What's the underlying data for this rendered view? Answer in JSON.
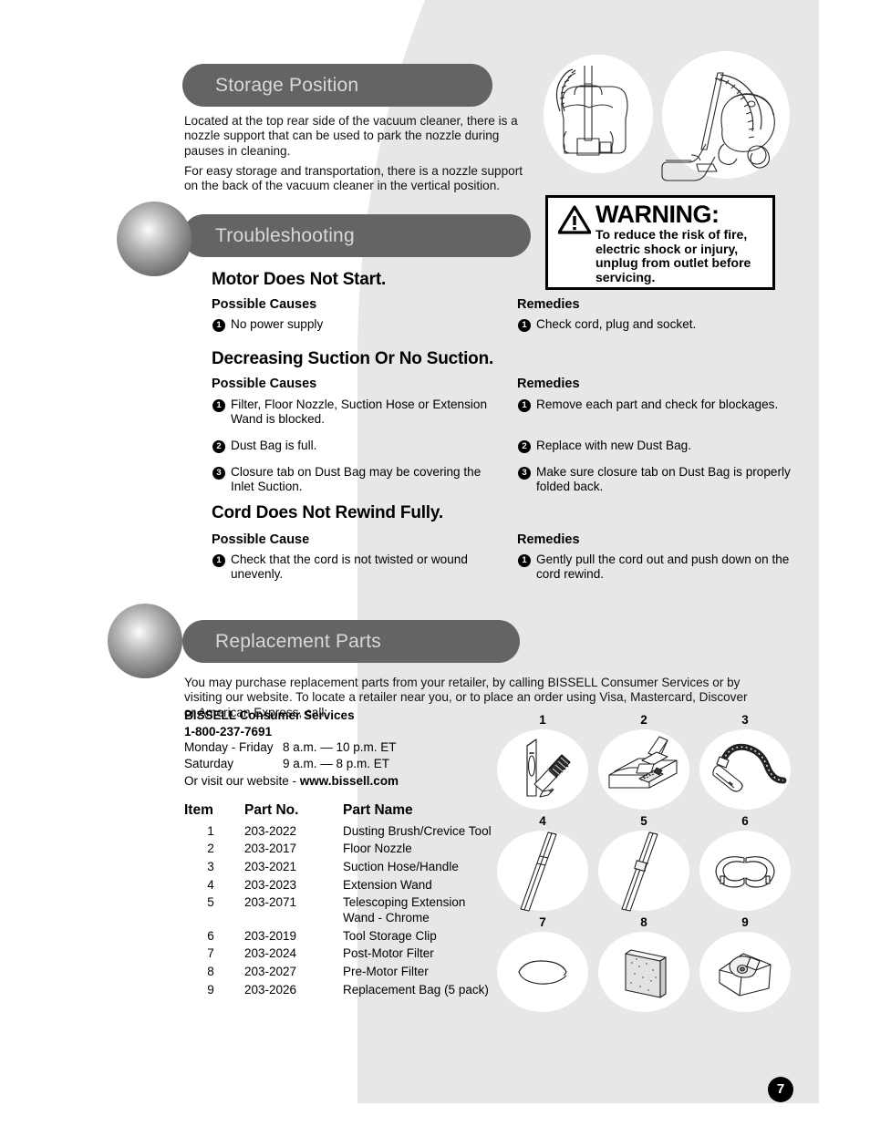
{
  "page": {
    "number": "7"
  },
  "sections": {
    "storage": {
      "title": "Storage Position",
      "paragraphs": [
        "Located at the top rear side of the vacuum cleaner, there is a nozzle support that can be used to park the nozzle during pauses in cleaning.",
        "For easy storage and transportation, there is a nozzle support on the back of the vacuum cleaner in the vertical position."
      ]
    },
    "troubleshooting": {
      "title": "Troubleshooting",
      "problems": [
        {
          "title": "Motor Does Not Start.",
          "causes_heading": "Possible Causes",
          "remedies_heading": "Remedies",
          "causes": [
            {
              "num": "1",
              "text": "No power supply"
            }
          ],
          "remedies": [
            {
              "num": "1",
              "text": "Check cord, plug and socket."
            }
          ]
        },
        {
          "title": "Decreasing Suction Or No Suction.",
          "causes_heading": "Possible Causes",
          "remedies_heading": "Remedies",
          "causes": [
            {
              "num": "1",
              "text": "Filter, Floor Nozzle, Suction Hose or Extension Wand is blocked."
            },
            {
              "num": "2",
              "text": "Dust Bag is full."
            },
            {
              "num": "3",
              "text": "Closure tab on Dust Bag may be covering the Inlet Suction."
            }
          ],
          "remedies": [
            {
              "num": "1",
              "text": "Remove each part and check for blockages."
            },
            {
              "num": "2",
              "text": "Replace with new Dust Bag."
            },
            {
              "num": "3",
              "text": "Make sure closure tab on Dust Bag is properly folded back."
            }
          ]
        },
        {
          "title": "Cord Does Not Rewind Fully.",
          "causes_heading": "Possible Cause",
          "remedies_heading": "Remedies",
          "causes": [
            {
              "num": "1",
              "text": "Check that the cord is not twisted or wound unevenly."
            }
          ],
          "remedies": [
            {
              "num": "1",
              "text": "Gently pull the cord out and push down on the cord rewind."
            }
          ]
        }
      ]
    },
    "replacement": {
      "title": "Replacement Parts",
      "intro": "You may purchase replacement parts from your retailer, by calling BISSELL Consumer Services or by visiting our website. To locate a retailer near you, or to place an order using Visa, Mastercard, Discover or American Express, call:",
      "contact": {
        "name": "BISSELL Consumer Services",
        "phone": "1-800-237-7691",
        "hours": [
          {
            "days": "Monday - Friday",
            "time": "8 a.m. — 10 p.m. ET"
          },
          {
            "days": "Saturday",
            "time": "9 a.m. — 8 p.m. ET"
          }
        ],
        "website_prefix": "Or visit our website - ",
        "website": "www.bissell.com"
      },
      "table": {
        "headers": [
          "Item",
          "Part No.",
          "Part Name"
        ],
        "rows": [
          {
            "item": "1",
            "part_no": "203-2022",
            "name": "Dusting Brush/Crevice Tool"
          },
          {
            "item": "2",
            "part_no": "203-2017",
            "name": "Floor Nozzle"
          },
          {
            "item": "3",
            "part_no": "203-2021",
            "name": "Suction Hose/Handle"
          },
          {
            "item": "4",
            "part_no": "203-2023",
            "name": "Extension Wand"
          },
          {
            "item": "5",
            "part_no": "203-2071",
            "name": "Telescoping Extension Wand - Chrome"
          },
          {
            "item": "6",
            "part_no": "203-2019",
            "name": "Tool Storage Clip"
          },
          {
            "item": "7",
            "part_no": "203-2024",
            "name": "Post-Motor Filter"
          },
          {
            "item": "8",
            "part_no": "203-2027",
            "name": "Pre-Motor Filter"
          },
          {
            "item": "9",
            "part_no": "203-2026",
            "name": "Replacement Bag (5 pack)"
          }
        ]
      },
      "figures": [
        {
          "num": "1",
          "icon": "dusting-brush-crevice-tool-illustration"
        },
        {
          "num": "2",
          "icon": "floor-nozzle-illustration"
        },
        {
          "num": "3",
          "icon": "suction-hose-handle-illustration"
        },
        {
          "num": "4",
          "icon": "extension-wand-illustration"
        },
        {
          "num": "5",
          "icon": "telescoping-extension-wand-illustration"
        },
        {
          "num": "6",
          "icon": "tool-storage-clip-illustration"
        },
        {
          "num": "7",
          "icon": "post-motor-filter-illustration"
        },
        {
          "num": "8",
          "icon": "pre-motor-filter-illustration"
        },
        {
          "num": "9",
          "icon": "replacement-bag-illustration"
        }
      ]
    }
  },
  "warning": {
    "icon": "warning-triangle-icon",
    "title": "WARNING:",
    "body": "To reduce the risk of fire, electric shock or injury, unplug from outlet before servicing."
  },
  "illustrations": {
    "top_left": "vacuum-rear-nozzle-support-illustration",
    "top_right": "vacuum-vertical-storage-position-illustration"
  },
  "colors": {
    "bar": "#646464",
    "bar_text": "#d9d9d9",
    "background_swoosh": "#e7e7e7",
    "page_number_bg": "#000000"
  }
}
